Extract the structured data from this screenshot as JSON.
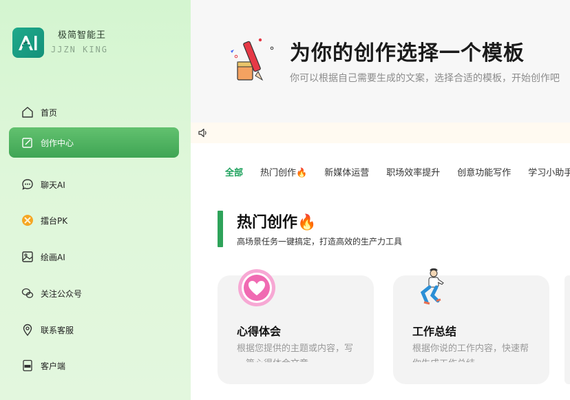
{
  "brand": {
    "name": "极简智能王",
    "sub": "JJZN KING",
    "logo_text": "AI"
  },
  "sidebar": {
    "items": [
      {
        "label": "首页",
        "icon": "home-icon"
      },
      {
        "label": "创作中心",
        "icon": "edit-icon",
        "active": true
      },
      {
        "label": "聊天AI",
        "icon": "chat-icon"
      },
      {
        "label": "擂台PK",
        "icon": "pk-badge-icon"
      },
      {
        "label": "绘画AI",
        "icon": "image-icon"
      },
      {
        "label": "关注公众号",
        "icon": "wechat-icon"
      },
      {
        "label": "联系客服",
        "icon": "location-icon"
      },
      {
        "label": "客户端",
        "icon": "app-icon"
      }
    ]
  },
  "hero": {
    "title": "为你的创作选择一个模板",
    "subtitle": "你可以根据自己需要生成的文案，选择合适的模板，开始创作吧"
  },
  "tabs": [
    "全部",
    "热门创作🔥",
    "新媒体运营",
    "职场效率提升",
    "创意功能写作",
    "学习小助手"
  ],
  "active_tab": "全部",
  "section": {
    "title": "热门创作🔥",
    "subtitle": "高场景任务一键搞定，打造高效的生产力工具"
  },
  "cards": [
    {
      "title": "心得体会",
      "desc": "根据您提供的主题或内容，写一篇心得体会文章",
      "icon": "heart-icon"
    },
    {
      "title": "工作总结",
      "desc": "根据你说的工作内容，快速帮你生成工作总结",
      "icon": "person-illustration-icon"
    }
  ],
  "colors": {
    "accent": "#1aa05a",
    "sidebar_bg": "#dff7da",
    "active_nav": "#4caf5f",
    "heart": "#f06ab2"
  }
}
